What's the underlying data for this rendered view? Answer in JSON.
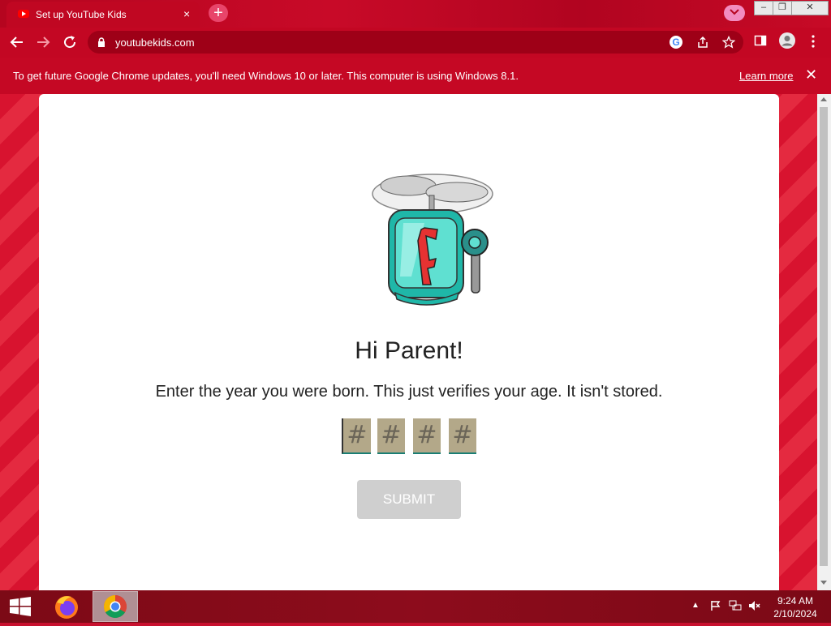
{
  "browser": {
    "tab_title": "Set up YouTube Kids",
    "tab_close": "×",
    "new_tab": "+",
    "url": "youtubekids.com",
    "window_controls": {
      "minimize": "–",
      "maximize": "❐",
      "close": "✕"
    }
  },
  "infobar": {
    "message": "To get future Google Chrome updates, you'll need Windows 10 or later. This computer is using Windows 8.1.",
    "link": "Learn more",
    "close": "✕"
  },
  "page": {
    "heading": "Hi Parent!",
    "subtext": "Enter the year you were born. This just verifies your age. It isn't stored.",
    "digit_placeholders": [
      "#",
      "#",
      "#",
      "#"
    ],
    "submit_label": "SUBMIT"
  },
  "taskbar": {
    "time": "9:24 AM",
    "date": "2/10/2024"
  },
  "colors": {
    "brand": "#c8102e",
    "submit_disabled": "#cfcfcf"
  },
  "icons": [
    "back-icon",
    "forward-icon",
    "reload-icon",
    "lock-icon",
    "google-icon",
    "share-icon",
    "bookmark-star-icon",
    "sidepanel-icon",
    "profile-icon",
    "menu-icon"
  ]
}
